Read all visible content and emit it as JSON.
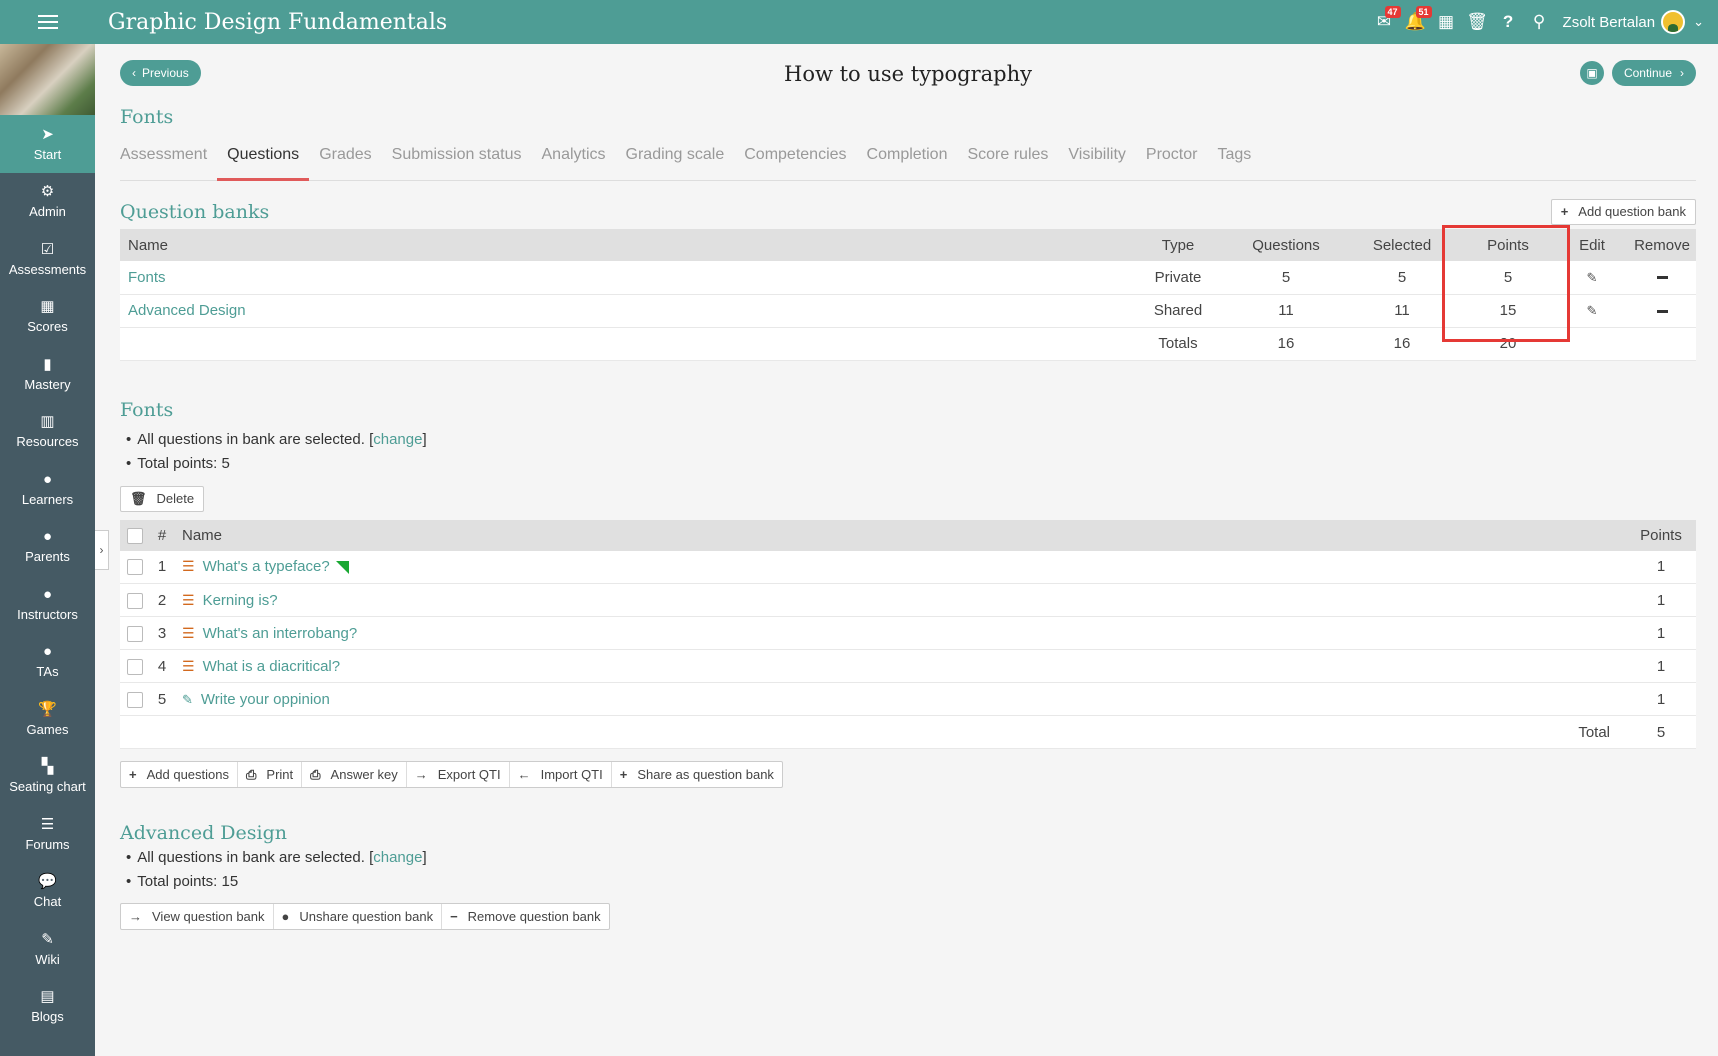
{
  "app": {
    "course_title": "Graphic Design Fundamentals",
    "user_name": "Zsolt Bertalan",
    "messages_count": "47",
    "notifications_count": "51"
  },
  "sidebar": {
    "items": [
      {
        "label": "Start",
        "icon": "navigation-arrow-icon"
      },
      {
        "label": "Admin",
        "icon": "gear-icon"
      },
      {
        "label": "Assessments",
        "icon": "checklist-icon"
      },
      {
        "label": "Scores",
        "icon": "grid-icon"
      },
      {
        "label": "Mastery",
        "icon": "bar-chart-icon"
      },
      {
        "label": "Resources",
        "icon": "books-icon"
      },
      {
        "label": "Learners",
        "icon": "person-icon"
      },
      {
        "label": "Parents",
        "icon": "person-icon"
      },
      {
        "label": "Instructors",
        "icon": "person-icon"
      },
      {
        "label": "TAs",
        "icon": "person-icon"
      },
      {
        "label": "Games",
        "icon": "trophy-icon"
      },
      {
        "label": "Seating chart",
        "icon": "seating-icon"
      },
      {
        "label": "Forums",
        "icon": "list-icon"
      },
      {
        "label": "Chat",
        "icon": "chat-bubble-icon"
      },
      {
        "label": "Wiki",
        "icon": "edit-square-icon"
      },
      {
        "label": "Blogs",
        "icon": "calendar-icon"
      }
    ]
  },
  "header": {
    "previous_label": "Previous",
    "continue_label": "Continue",
    "lesson_title": "How to use typography",
    "section_title": "Fonts"
  },
  "tabs": [
    {
      "label": "Assessment"
    },
    {
      "label": "Questions"
    },
    {
      "label": "Grades"
    },
    {
      "label": "Submission status"
    },
    {
      "label": "Analytics"
    },
    {
      "label": "Grading scale"
    },
    {
      "label": "Competencies"
    },
    {
      "label": "Completion"
    },
    {
      "label": "Score rules"
    },
    {
      "label": "Visibility"
    },
    {
      "label": "Proctor"
    },
    {
      "label": "Tags"
    }
  ],
  "question_banks": {
    "title": "Question banks",
    "add_label": "Add question bank",
    "columns": {
      "name": "Name",
      "type": "Type",
      "questions": "Questions",
      "selected": "Selected",
      "points": "Points",
      "edit": "Edit",
      "remove": "Remove"
    },
    "rows": [
      {
        "name": "Fonts",
        "type": "Private",
        "questions": "5",
        "selected": "5",
        "points": "5"
      },
      {
        "name": "Advanced Design",
        "type": "Shared",
        "questions": "11",
        "selected": "11",
        "points": "15"
      }
    ],
    "totals": {
      "label": "Totals",
      "questions": "16",
      "selected": "16",
      "points": "20"
    }
  },
  "fonts_section": {
    "title": "Fonts",
    "all_selected": "All questions in bank are selected. [",
    "change": "change",
    "close_bracket": "]",
    "total_points": "Total points: 5",
    "delete_label": "Delete",
    "columns": {
      "num": "#",
      "name": "Name",
      "points": "Points"
    },
    "questions": [
      {
        "num": "1",
        "name": "What's a typeface?",
        "points": "1",
        "icon": "list-icon",
        "flag": true
      },
      {
        "num": "2",
        "name": "Kerning is?",
        "points": "1",
        "icon": "list-icon"
      },
      {
        "num": "3",
        "name": "What's an interrobang?",
        "points": "1",
        "icon": "list-icon"
      },
      {
        "num": "4",
        "name": "What is a diacritical?",
        "points": "1",
        "icon": "list-icon"
      },
      {
        "num": "5",
        "name": "Write your oppinion",
        "points": "1",
        "icon": "pencil-icon"
      }
    ],
    "total_label": "Total",
    "total_value": "5",
    "toolbar": {
      "add_questions": "Add questions",
      "print": "Print",
      "answer_key": "Answer key",
      "export_qti": "Export QTI",
      "import_qti": "Import QTI",
      "share": "Share as question bank"
    }
  },
  "advanced_section": {
    "title": "Advanced Design",
    "all_selected": "All questions in bank are selected. [",
    "change": "change",
    "close_bracket": "]",
    "total_points": "Total points: 15",
    "toolbar": {
      "view": "View question bank",
      "unshare": "Unshare question bank",
      "remove": "Remove question bank"
    }
  },
  "colors": {
    "accent": "#4e9d95",
    "sidebar": "#455a64",
    "active_tab_underline": "#e05a5a",
    "highlight": "#e53935"
  }
}
